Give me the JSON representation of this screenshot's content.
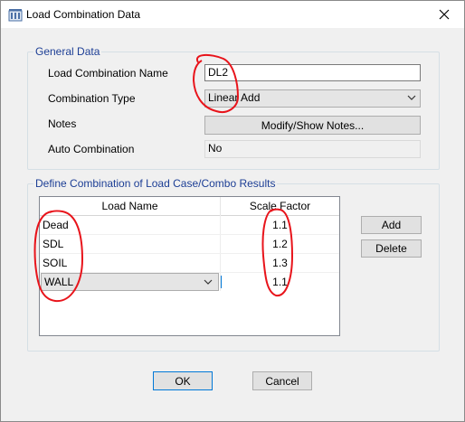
{
  "window": {
    "title": "Load Combination Data",
    "close_icon": "close-icon"
  },
  "general": {
    "legend": "General Data",
    "name_label": "Load Combination Name",
    "name_value": "DL2",
    "type_label": "Combination Type",
    "type_value": "Linear Add",
    "notes_label": "Notes",
    "notes_button": "Modify/Show Notes...",
    "auto_label": "Auto Combination",
    "auto_value": "No"
  },
  "define": {
    "legend": "Define Combination of Load Case/Combo Results",
    "columns": [
      "Load Name",
      "Scale Factor"
    ],
    "rows": [
      {
        "name": "Dead",
        "factor": "1.1"
      },
      {
        "name": "SDL",
        "factor": "1.2"
      },
      {
        "name": "SOIL",
        "factor": "1.3"
      },
      {
        "name": "WALL",
        "factor": "1.1"
      }
    ],
    "add_button": "Add",
    "delete_button": "Delete"
  },
  "footer": {
    "ok_button": "OK",
    "cancel_button": "Cancel"
  },
  "colors": {
    "legend_text": "#1c3e95",
    "annotation": "#e8141b",
    "focus": "#0078d7"
  }
}
